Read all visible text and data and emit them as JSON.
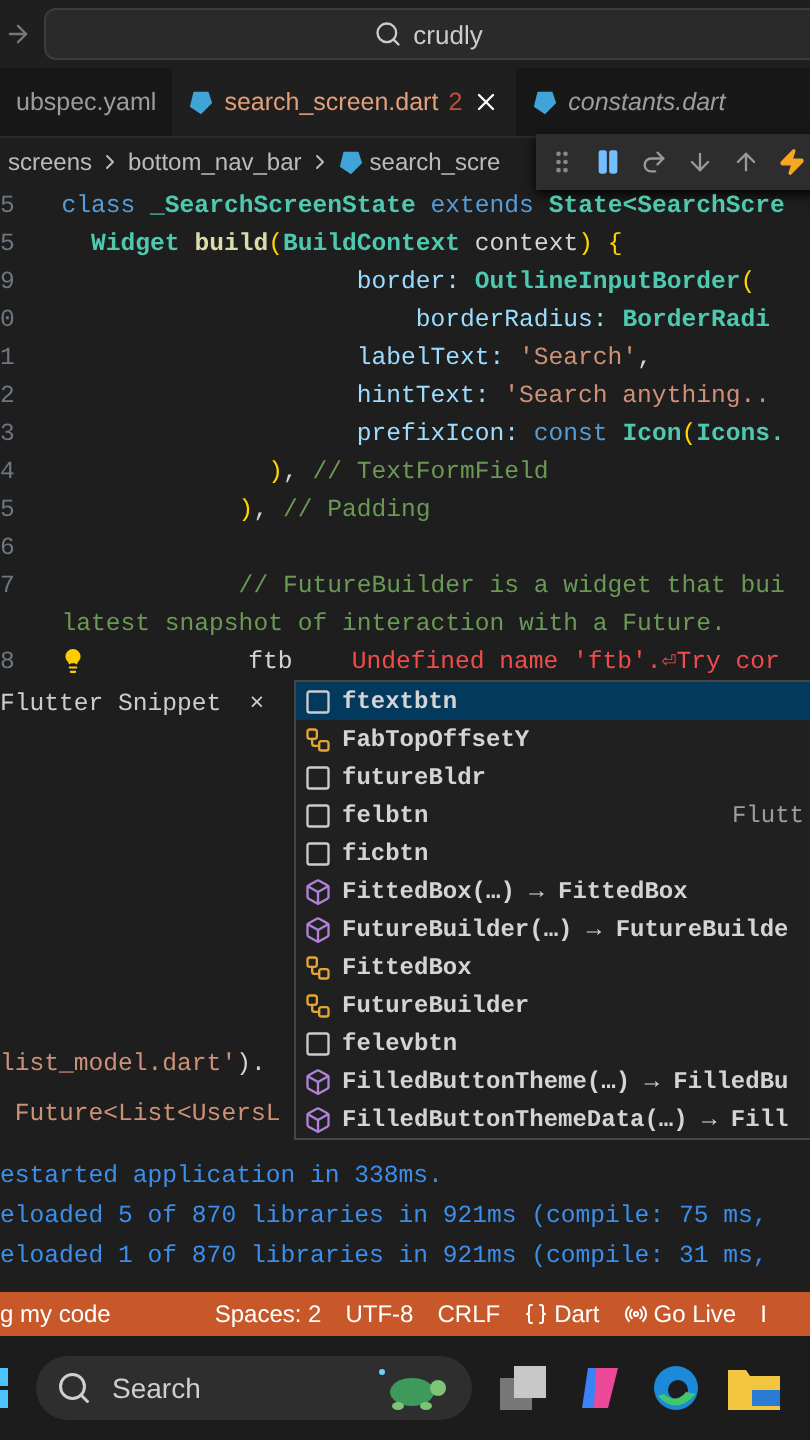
{
  "title_bar": {
    "search": "crudly"
  },
  "tabs": [
    {
      "label": "ubspec.yaml",
      "selected": false,
      "preview": false
    },
    {
      "label": "search_screen.dart",
      "badge": "2",
      "selected": true,
      "preview": false
    },
    {
      "label": "constants.dart",
      "selected": false,
      "preview": true
    }
  ],
  "breadcrumb": [
    "screens",
    "bottom_nav_bar",
    "search_scre"
  ],
  "editor": {
    "lines": [
      {
        "number": "5",
        "tokens": [
          {
            "text": "  class ",
            "kind": "keyword"
          },
          {
            "text": "_SearchScreenState ",
            "kind": "type"
          },
          {
            "text": "extends ",
            "kind": "keyword"
          },
          {
            "text": "State<SearchScre",
            "kind": "type"
          }
        ]
      },
      {
        "number": "5",
        "tokens": [
          {
            "text": "    Widget ",
            "kind": "type"
          },
          {
            "text": "build",
            "kind": "func"
          },
          {
            "text": "(",
            "kind": "paren"
          },
          {
            "text": "BuildContext ",
            "kind": "type"
          },
          {
            "text": "context",
            "kind": "plain"
          },
          {
            "text": ") {",
            "kind": "paren"
          }
        ]
      },
      {
        "number": "9",
        "tokens": [
          {
            "text": "                      border: ",
            "kind": "prop"
          },
          {
            "text": "OutlineInputBorder",
            "kind": "type"
          },
          {
            "text": "(",
            "kind": "paren"
          }
        ]
      },
      {
        "number": "0",
        "tokens": [
          {
            "text": "                          borderRadius: ",
            "kind": "prop"
          },
          {
            "text": "BorderRadi",
            "kind": "type"
          }
        ]
      },
      {
        "number": "1",
        "tokens": [
          {
            "text": "                      labelText: ",
            "kind": "prop"
          },
          {
            "text": "'Search'",
            "kind": "string"
          },
          {
            "text": ",",
            "kind": "plain"
          }
        ]
      },
      {
        "number": "2",
        "tokens": [
          {
            "text": "                      hintText: ",
            "kind": "prop"
          },
          {
            "text": "'Search anything..",
            "kind": "string"
          }
        ]
      },
      {
        "number": "3",
        "tokens": [
          {
            "text": "                      prefixIcon: ",
            "kind": "prop"
          },
          {
            "text": "const ",
            "kind": "keyword"
          },
          {
            "text": "Icon",
            "kind": "type"
          },
          {
            "text": "(",
            "kind": "paren"
          },
          {
            "text": "Icons.",
            "kind": "type"
          }
        ]
      },
      {
        "number": "4",
        "tokens": [
          {
            "text": "                )",
            "kind": "paren"
          },
          {
            "text": ", ",
            "kind": "plain"
          },
          {
            "text": "// TextFormField",
            "kind": "comment"
          }
        ]
      },
      {
        "number": "5",
        "tokens": [
          {
            "text": "              )",
            "kind": "paren"
          },
          {
            "text": ", ",
            "kind": "plain"
          },
          {
            "text": "// Padding",
            "kind": "comment"
          }
        ]
      },
      {
        "number": "6"
      },
      {
        "number": "7",
        "tokens": [
          {
            "text": "              // FutureBuilder is a widget that bui",
            "kind": "comment"
          }
        ]
      },
      {
        "tokens": [
          {
            "text": "  latest snapshot of interaction with a Future.",
            "kind": "comment"
          }
        ]
      },
      {
        "number": "8",
        "bulb": true,
        "tokens": [
          {
            "text": "           ftb",
            "kind": "plain"
          },
          {
            "text": "    Undefined name 'ftb'.⏎Try cor",
            "kind": "error"
          }
        ]
      }
    ]
  },
  "snippet_panel": {
    "title": "Flutter Snippet",
    "close": "×"
  },
  "below_lines": [
    {
      "tokens": [
        {
          "text": "list_model.dart'",
          "kind": "string"
        },
        {
          "text": ").",
          "kind": "plain"
        }
      ]
    },
    {
      "tokens": [
        {
          "text": " Future<List<UsersL",
          "kind": "string"
        }
      ]
    }
  ],
  "suggestions": [
    {
      "label": "ftextbtn",
      "kind": "snippet",
      "selected": true
    },
    {
      "label": "FabTopOffsetY",
      "kind": "field",
      "selected": false
    },
    {
      "label": "futureBldr",
      "kind": "snippet",
      "selected": false
    },
    {
      "label": "felbtn",
      "kind": "snippet",
      "detail": "Flutt",
      "selected": false
    },
    {
      "label": "ficbtn",
      "kind": "snippet",
      "selected": false
    },
    {
      "label": "FittedBox(…) → FittedBox",
      "kind": "constructor",
      "selected": false
    },
    {
      "label": "FutureBuilder(…) → FutureBuilde",
      "kind": "constructor",
      "selected": false
    },
    {
      "label": "FittedBox",
      "kind": "field",
      "selected": false
    },
    {
      "label": "FutureBuilder",
      "kind": "field",
      "selected": false
    },
    {
      "label": "felevbtn",
      "kind": "snippet",
      "selected": false
    },
    {
      "label": "FilledButtonTheme(…) → FilledBu",
      "kind": "constructor",
      "selected": false
    },
    {
      "label": "FilledButtonThemeData(…) → Fill",
      "kind": "constructor",
      "selected": false
    }
  ],
  "terminal": [
    "estarted application in 338ms.",
    "eloaded 5 of 870 libraries in 921ms (compile: 75 ms,",
    "eloaded 1 of 870 libraries in 921ms (compile: 31 ms,"
  ],
  "status_bar": [
    {
      "label": "g my code",
      "kind": "text"
    },
    {
      "label": "Spaces: 2",
      "kind": "text"
    },
    {
      "label": "UTF-8",
      "kind": "text"
    },
    {
      "label": "CRLF",
      "kind": "text"
    },
    {
      "label": "Dart",
      "kind": "language"
    },
    {
      "label": "Go Live",
      "kind": "live"
    },
    {
      "label": "I",
      "kind": "text"
    }
  ],
  "taskbar": {
    "search": "Search"
  }
}
